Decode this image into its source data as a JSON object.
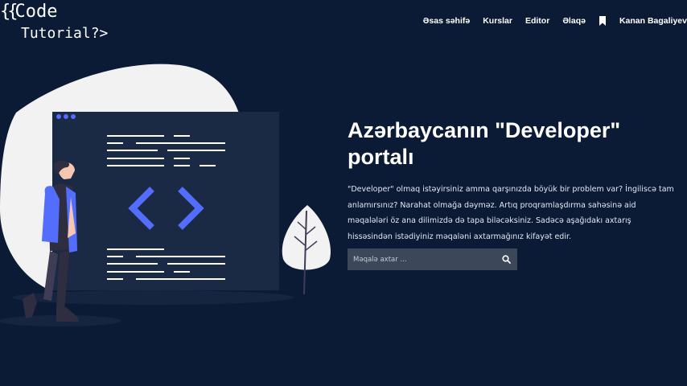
{
  "logo": {
    "line1_brace": "{{",
    "line1_text": "Code",
    "line2_text": "Tutorial",
    "line2_suffix": "?>"
  },
  "nav": {
    "items": [
      {
        "label": "Əsas səhifə"
      },
      {
        "label": "Kurslar"
      },
      {
        "label": "Editor"
      },
      {
        "label": "Əlaqə"
      }
    ],
    "bookmark_icon": "bookmark-icon",
    "user_name": "Kanan Bagaliyev"
  },
  "hero": {
    "title_line1": "Azərbaycanın \"Developer\"",
    "title_line2": "portalı",
    "text_lines": [
      "\"Developer\" olmaq istəyirsiniz amma qarşınızda böyük bir problem var? İngiliscə tam",
      "anlamırsınız? Narahat olmağa dəyməz. Artıq proqramlaşdırma sahəsinə aid",
      "məqalələri öz ana dilimizdə də tapa biləcəksiniz. Sadəcə aşağıdakı axtarış",
      "hissəsindən istədiyiniz məqaləni axtarmağınız kifayət edir."
    ]
  },
  "search": {
    "placeholder": "Məqalə axtar ...",
    "value": "",
    "icon": "search-icon"
  },
  "colors": {
    "background": "#0b1a35",
    "accent": "#536dfe",
    "window": "#1b2a44",
    "blob": "#f2f2f2"
  }
}
